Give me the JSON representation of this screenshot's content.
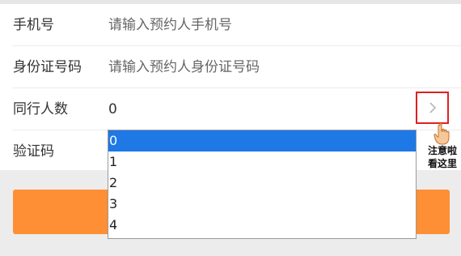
{
  "form": {
    "phone": {
      "label": "手机号",
      "placeholder": "请输入预约人手机号"
    },
    "id_card": {
      "label": "身份证号码",
      "placeholder": "请输入预约人身份证号码"
    },
    "companions": {
      "label": "同行人数",
      "value": "0"
    },
    "verify_code": {
      "label": "验证码"
    }
  },
  "companion_dropdown": {
    "options": [
      "0",
      "1",
      "2",
      "3",
      "4"
    ],
    "selected": "0"
  },
  "annotation": {
    "line1": "注意啦",
    "line2": "看这里",
    "highlight_color": "#e02020"
  },
  "colors": {
    "submit_button": "#ff8f35",
    "selected_option": "#1e78e6"
  }
}
